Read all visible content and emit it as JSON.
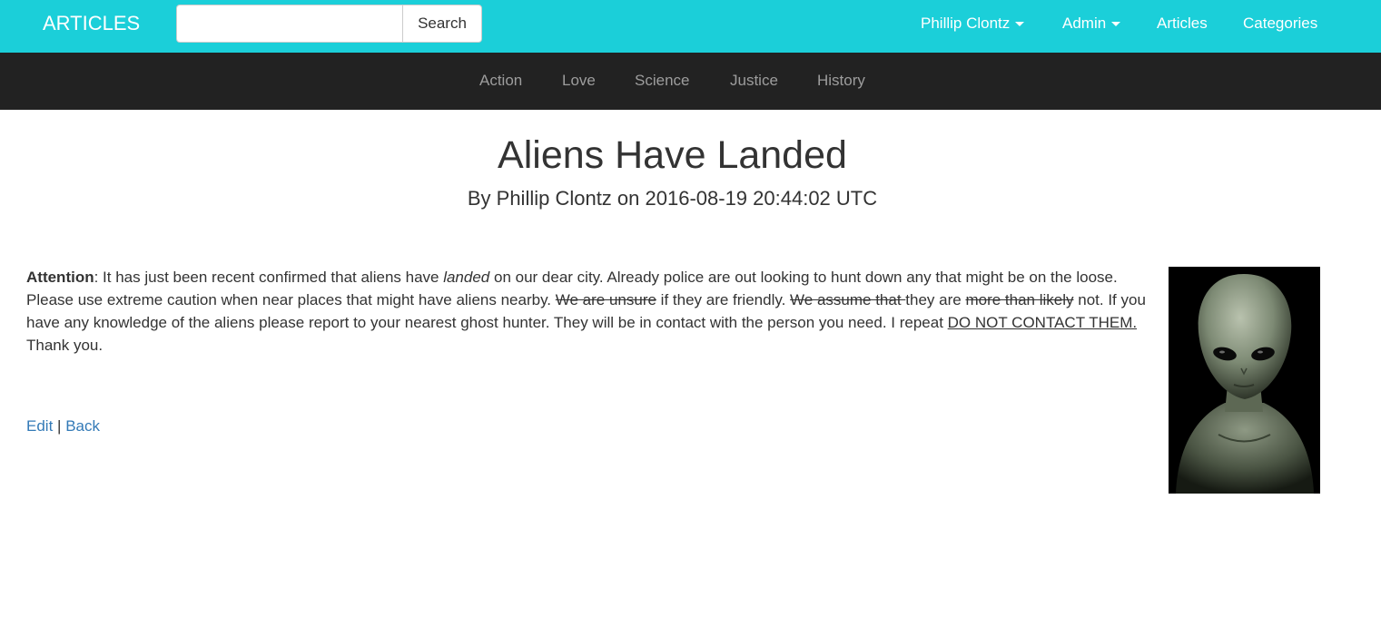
{
  "navbar": {
    "brand": "ARTICLES",
    "search_placeholder": "",
    "search_button": "Search",
    "items": {
      "user": "Phillip Clontz",
      "admin": "Admin",
      "articles": "Articles",
      "categories": "Categories"
    }
  },
  "categories": [
    "Action",
    "Love",
    "Science",
    "Justice",
    "History"
  ],
  "article": {
    "title": "Aliens Have Landed",
    "byline": "By Phillip Clontz on 2016-08-19 20:44:02 UTC",
    "body": {
      "bold_lead": "Attention",
      "t1": ": It has just been recent confirmed that aliens have ",
      "italic1": "landed",
      "t2": " on our dear city. Already police are out looking to hunt down any that might be on the loose. Please use extreme caution when near places that might have aliens nearby. ",
      "strike1": "We are unsure",
      "t3": " if they are friendly. ",
      "strike2": "We assume that ",
      "t4": "they are ",
      "strike3": "more than likely",
      "t5": " not. If you have any knowledge of the aliens please report to your nearest ghost hunter. They will be in contact with the person you need. I repeat ",
      "underline1": "DO NOT CONTACT THEM.",
      "t6": " Thank you."
    },
    "image_subject": "grey alien portrait"
  },
  "actions": {
    "edit": "Edit",
    "separator": "|",
    "back": "Back"
  },
  "colors": {
    "topbar": "#1bcfd9",
    "catbar": "#222222",
    "link": "#337ab7"
  }
}
